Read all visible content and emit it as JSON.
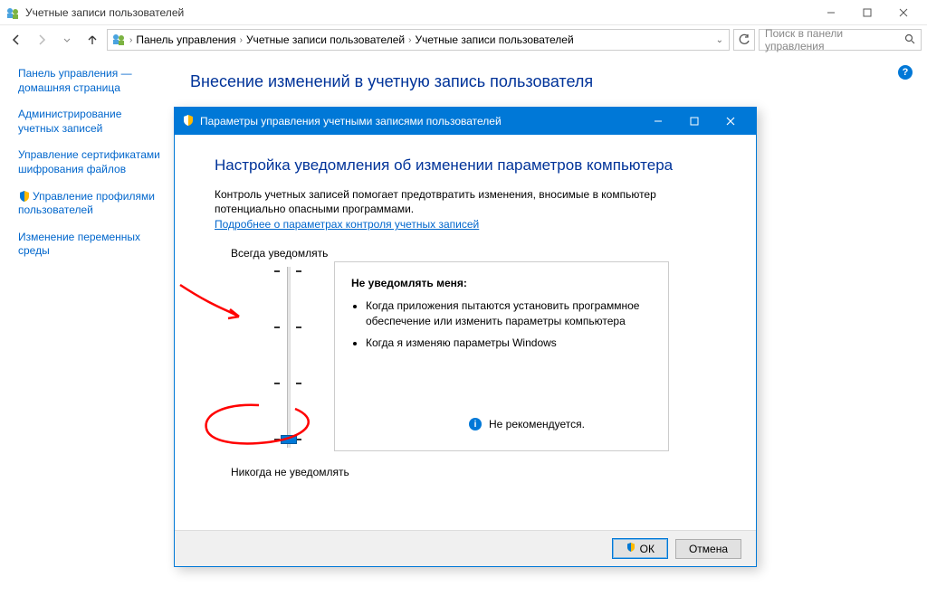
{
  "window": {
    "title": "Учетные записи пользователей"
  },
  "breadcrumb": {
    "seg1": "Панель управления",
    "seg2": "Учетные записи пользователей",
    "seg3": "Учетные записи пользователей"
  },
  "search": {
    "placeholder": "Поиск в панели управления"
  },
  "sidebar": {
    "home": "Панель управления — домашняя страница",
    "items": [
      "Администрирование учетных записей",
      "Управление сертификатами шифрования файлов",
      "Управление профилями пользователей",
      "Изменение переменных среды"
    ]
  },
  "main": {
    "heading": "Внесение изменений в учетную запись пользователя"
  },
  "dialog": {
    "title": "Параметры управления учетными записями пользователей",
    "heading": "Настройка уведомления об изменении параметров компьютера",
    "desc": "Контроль учетных записей помогает предотвратить изменения, вносимые в компьютер потенциально опасными программами.",
    "link": "Подробнее о параметрах контроля учетных записей",
    "slider_top": "Всегда уведомлять",
    "slider_bot": "Никогда не уведомлять",
    "info_title": "Не уведомлять меня:",
    "info_items": [
      "Когда приложения пытаются установить программное обеспечение или изменить параметры компьютера",
      "Когда я изменяю параметры Windows"
    ],
    "info_warn": "Не рекомендуется.",
    "ok": "ОК",
    "cancel": "Отмена"
  }
}
